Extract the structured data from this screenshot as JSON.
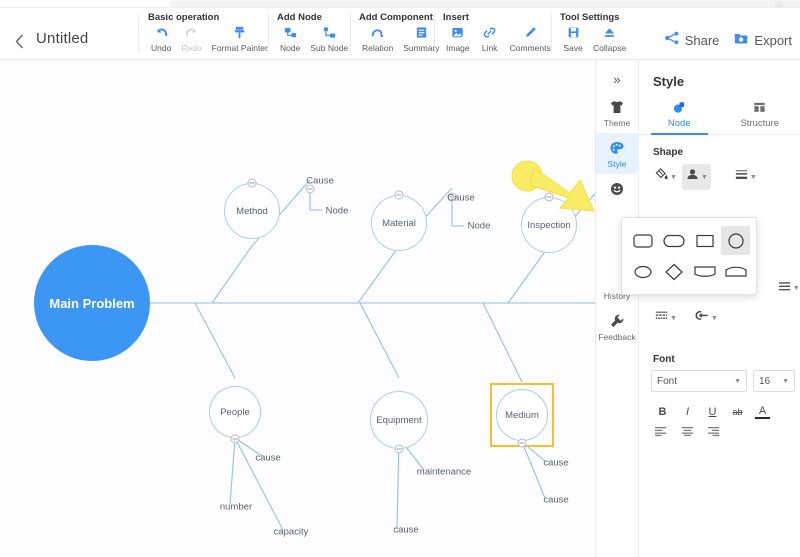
{
  "app": {
    "back_icon": "chevron-left-icon",
    "doc_title": "Untitled"
  },
  "toolbar": {
    "groups": [
      {
        "name": "basic-operation",
        "label": "Basic operation",
        "items": [
          {
            "label": "Undo",
            "icon": "undo-arrow-icon",
            "disabled": false
          },
          {
            "label": "Redo",
            "icon": "redo-arrow-icon",
            "disabled": true
          },
          {
            "label": "Format Painter",
            "icon": "format-painter-icon",
            "disabled": false
          }
        ]
      },
      {
        "name": "add-node",
        "label": "Add Node",
        "items": [
          {
            "label": "Node",
            "icon": "node-icon",
            "disabled": false
          },
          {
            "label": "Sub Node",
            "icon": "sub-node-icon",
            "disabled": false
          }
        ]
      },
      {
        "name": "add-component",
        "label": "Add Component",
        "items": [
          {
            "label": "Relation",
            "icon": "relation-icon",
            "disabled": false
          },
          {
            "label": "Summary",
            "icon": "summary-icon",
            "disabled": false
          }
        ]
      },
      {
        "name": "insert",
        "label": "Insert",
        "items": [
          {
            "label": "Image",
            "icon": "image-icon",
            "disabled": false
          },
          {
            "label": "Link",
            "icon": "link-icon",
            "disabled": false
          },
          {
            "label": "Comments",
            "icon": "comments-pencil-icon",
            "disabled": false
          }
        ]
      },
      {
        "name": "tool-settings",
        "label": "Tool Settings",
        "items": [
          {
            "label": "Save",
            "icon": "save-disk-icon",
            "disabled": false
          },
          {
            "label": "Collapse",
            "icon": "collapse-icon",
            "disabled": false
          }
        ]
      }
    ],
    "share_label": "Share",
    "share_icon": "share-nodes-icon",
    "export_label": "Export",
    "export_icon": "export-folder-icon"
  },
  "canvas": {
    "main_problem": "Main Problem",
    "branches": [
      {
        "label": "Method"
      },
      {
        "label": "Material"
      },
      {
        "label": "Inspection"
      },
      {
        "label": "People"
      },
      {
        "label": "Equipment"
      },
      {
        "label": "Medium",
        "selected": true
      }
    ],
    "leaf_labels": [
      {
        "text": "Cause"
      },
      {
        "text": "Node"
      },
      {
        "text": "Cause"
      },
      {
        "text": "Node"
      },
      {
        "text": "cause"
      },
      {
        "text": "number"
      },
      {
        "text": "capacity"
      },
      {
        "text": "maintenance"
      },
      {
        "text": "cause"
      },
      {
        "text": "cause"
      },
      {
        "text": "cause"
      }
    ],
    "colors": {
      "main_problem_fill": "#3b97f3",
      "branch_stroke": "#a8cdf2",
      "selection": "#f5bf2e",
      "pointer": "#f7ec63"
    }
  },
  "right_panel": {
    "expand_icon": "double-chevron-right-icon",
    "rail_items": [
      {
        "label": "Theme",
        "icon": "tshirt-icon",
        "active": false
      },
      {
        "label": "Style",
        "icon": "palette-icon",
        "active": true
      },
      {
        "label": "",
        "icon": "emoji-smiley-icon",
        "active": false
      },
      {
        "label": "History",
        "icon": "history-icon",
        "active": false
      },
      {
        "label": "Feedback",
        "icon": "wrench-icon",
        "active": false
      }
    ],
    "title": "Style",
    "tabs": [
      {
        "label": "Node",
        "icon": "node-shape-icon",
        "active": true
      },
      {
        "label": "Structure",
        "icon": "structure-grid-icon",
        "active": false
      }
    ],
    "shape_section_label": "Shape",
    "shape_tools": [
      {
        "name": "fill-color",
        "icon": "paint-bucket-icon",
        "active": false
      },
      {
        "name": "shape-picker",
        "icon": "shape-stamp-icon",
        "active": true
      },
      {
        "name": "border-style",
        "icon": "line-style-icon",
        "active": false
      }
    ],
    "shape_popup": {
      "open": true,
      "shapes": [
        {
          "name": "rounded-rectangle",
          "selected": false
        },
        {
          "name": "stadium",
          "selected": false
        },
        {
          "name": "rectangle",
          "selected": false
        },
        {
          "name": "circle",
          "selected": true
        },
        {
          "name": "ellipse",
          "selected": false
        },
        {
          "name": "diamond",
          "selected": false
        },
        {
          "name": "flag-bottom",
          "selected": false
        },
        {
          "name": "flag-top",
          "selected": false
        }
      ]
    },
    "text_tools_row1": [
      {
        "name": "text-highlight",
        "icon": "paint-bucket-icon",
        "underline": ""
      },
      {
        "name": "text-color",
        "icon": "pen-icon",
        "underline": "#2f8ef4"
      },
      {
        "name": "text-background",
        "icon": "box-fill-icon",
        "underline": "#2f8ef4"
      },
      {
        "name": "line-weight",
        "icon": "lines-icon",
        "underline": ""
      }
    ],
    "text_tools_row2": [
      {
        "name": "border-dash",
        "icon": "dashed-line-icon"
      },
      {
        "name": "arrow-style",
        "icon": "arrow-style-icon"
      }
    ],
    "font_section_label": "Font",
    "font_family_value": "Font",
    "font_size_value": "16",
    "format_buttons": [
      {
        "name": "bold",
        "glyph": "B"
      },
      {
        "name": "italic",
        "glyph": "I"
      },
      {
        "name": "underline",
        "glyph": "U"
      },
      {
        "name": "strikethrough",
        "glyph": "ab"
      },
      {
        "name": "font-color",
        "glyph": "A"
      }
    ],
    "align_buttons": [
      {
        "name": "align-left"
      },
      {
        "name": "align-center"
      },
      {
        "name": "align-right"
      }
    ]
  }
}
